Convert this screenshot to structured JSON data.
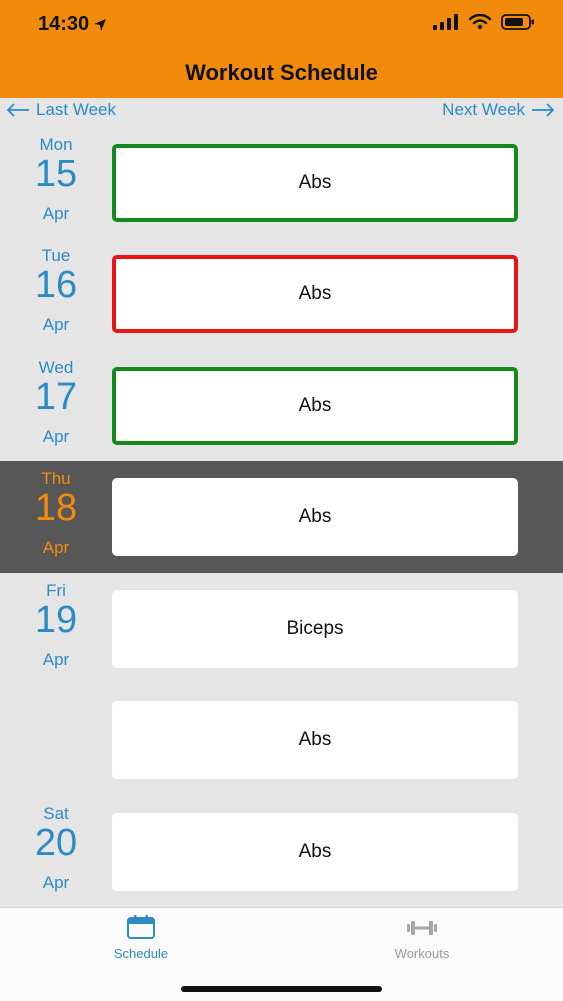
{
  "status_bar": {
    "time": "14:30"
  },
  "header": {
    "title": "Workout Schedule"
  },
  "week_nav": {
    "prev_label": "Last Week",
    "next_label": "Next Week"
  },
  "rows": [
    {
      "dow": "Mon",
      "day": "15",
      "month": "Apr",
      "workout": "Abs",
      "status": "completed"
    },
    {
      "dow": "Tue",
      "day": "16",
      "month": "Apr",
      "workout": "Abs",
      "status": "missed"
    },
    {
      "dow": "Wed",
      "day": "17",
      "month": "Apr",
      "workout": "Abs",
      "status": "completed"
    },
    {
      "dow": "Thu",
      "day": "18",
      "month": "Apr",
      "workout": "Abs",
      "status": "today"
    },
    {
      "dow": "Fri",
      "day": "19",
      "month": "Apr",
      "workout": "Biceps",
      "status": "scheduled"
    },
    {
      "dow": "",
      "day": "",
      "month": "",
      "workout": "Abs",
      "status": "scheduled"
    },
    {
      "dow": "Sat",
      "day": "20",
      "month": "Apr",
      "workout": "Abs",
      "status": "scheduled"
    }
  ],
  "tabs": [
    {
      "label": "Schedule",
      "icon": "calendar-icon",
      "active": true
    },
    {
      "label": "Workouts",
      "icon": "dumbbell-icon",
      "active": false
    }
  ],
  "colors": {
    "header": "#f28b0c",
    "accent": "#2b8cc5",
    "completed_border": "#14891c",
    "missed_border": "#e81515",
    "selected_row": "#585758"
  }
}
